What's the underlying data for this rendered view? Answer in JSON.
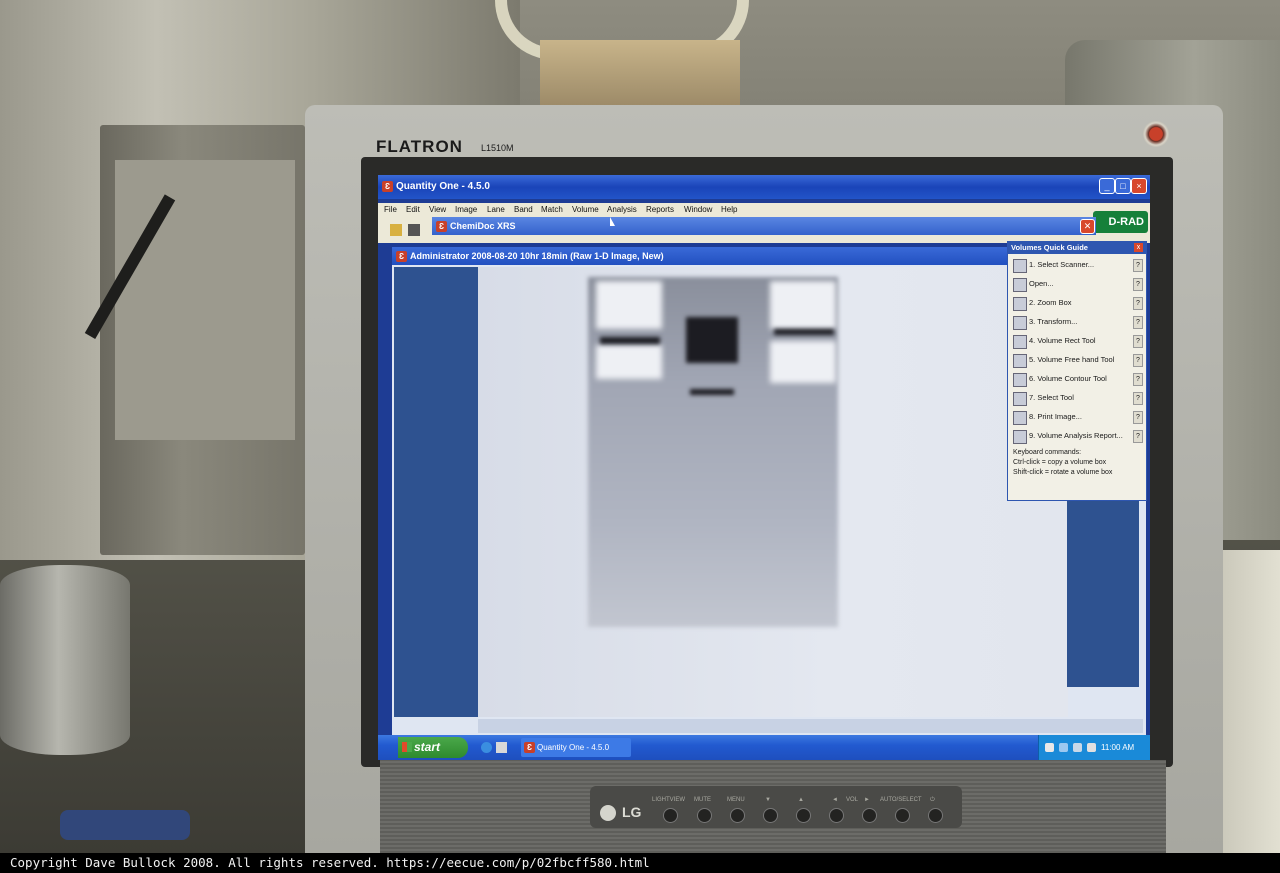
{
  "monitor": {
    "brand": "FLATRON",
    "model": "L1510M",
    "logo": "LG",
    "control_labels": [
      "LIGHTVIEW",
      "MUTE",
      "MENU",
      "▼",
      "▲",
      "◄",
      "VOL",
      "►",
      "AUTO/SELECT",
      "⏻"
    ]
  },
  "app": {
    "title": "Quantity One - 4.5.0",
    "menu": [
      "File",
      "Edit",
      "View",
      "Image",
      "Lane",
      "Band",
      "Match",
      "Volume",
      "Analysis",
      "Reports",
      "Window",
      "Help"
    ],
    "logo_text": "D-RAD",
    "accent_color": "#1a44b8"
  },
  "chemidoc": {
    "title": "ChemiDoc XRS",
    "close": "✕"
  },
  "image_window": {
    "title": "Administrator 2008-08-20 10hr 18min (Raw 1-D Image, New)"
  },
  "quick_guide": {
    "title": "Volumes Quick Guide",
    "close": "x",
    "items": [
      {
        "label": "1.   Select Scanner...",
        "help": "?",
        "icon": "scanner-icon"
      },
      {
        "label": "       Open...",
        "help": "?",
        "icon": "open-folder-icon"
      },
      {
        "label": "2.   Zoom Box",
        "help": "?",
        "icon": "zoom-icon"
      },
      {
        "label": "3.   Transform...",
        "help": "?",
        "icon": "transform-icon"
      },
      {
        "label": "4.   Volume Rect Tool",
        "help": "?",
        "icon": "rect-tool-icon"
      },
      {
        "label": "5.   Volume Free hand Tool",
        "help": "?",
        "icon": "freehand-icon"
      },
      {
        "label": "6.   Volume Contour Tool",
        "help": "?",
        "icon": "contour-icon"
      },
      {
        "label": "7.   Select Tool",
        "help": "?",
        "icon": "select-arrow-icon"
      },
      {
        "label": "8.   Print Image...",
        "help": "?",
        "icon": "print-icon"
      },
      {
        "label": "9.   Volume Analysis Report...",
        "help": "?",
        "icon": "report-icon"
      }
    ],
    "keyboard": [
      "Keyboard commands:",
      "Ctrl-click = copy a volume box",
      "Shift-click = rotate a volume box"
    ]
  },
  "taskbar": {
    "start": "start",
    "task": "Quantity One - 4.5.0",
    "clock": "11:00 AM"
  },
  "footer": {
    "copyright": "Copyright Dave Bullock 2008. All rights reserved. https://eecue.com/p/02fbcff580.html"
  }
}
